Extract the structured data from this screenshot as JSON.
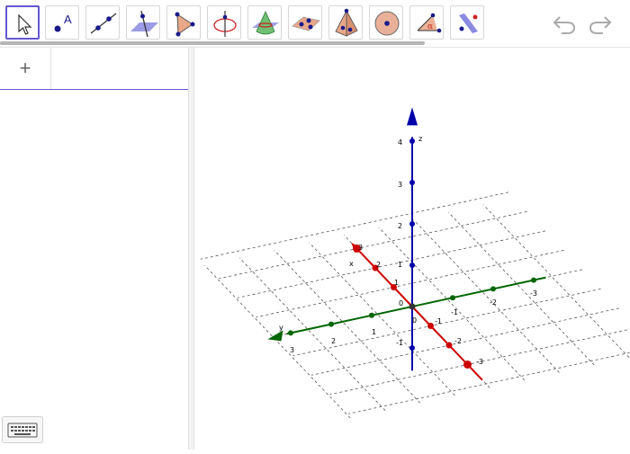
{
  "toolbar": {
    "tools": [
      {
        "name": "move-tool",
        "icon": "cursor-arrow-icon",
        "selected": true
      },
      {
        "name": "point-tool",
        "icon": "point-with-label-icon",
        "label": "A"
      },
      {
        "name": "line-tool",
        "icon": "line-through-points-icon"
      },
      {
        "name": "perpendicular-line-tool",
        "icon": "perpendicular-line-plane-icon"
      },
      {
        "name": "polygon-tool",
        "icon": "polygon-icon"
      },
      {
        "name": "circle-axis-tool",
        "icon": "circle-around-axis-icon"
      },
      {
        "name": "intersect-surfaces-tool",
        "icon": "intersect-surfaces-icon"
      },
      {
        "name": "plane-three-points-tool",
        "icon": "plane-through-points-icon"
      },
      {
        "name": "pyramid-tool",
        "icon": "pyramid-icon"
      },
      {
        "name": "sphere-tool",
        "icon": "sphere-icon"
      },
      {
        "name": "angle-tool",
        "icon": "angle-icon",
        "label": "α"
      },
      {
        "name": "reflect-plane-tool",
        "icon": "reflect-about-plane-icon"
      }
    ],
    "undo_icon": "undo-icon",
    "redo_icon": "redo-icon"
  },
  "algebra": {
    "add_label": "+",
    "keyboard_icon": "keyboard-icon"
  },
  "view3d": {
    "colors": {
      "x": "#cc0000",
      "y": "#006600",
      "z": "#0000aa",
      "grid": "#555555"
    },
    "z_axis": {
      "label": "z",
      "ticks": [
        "1",
        "2",
        "3",
        "4"
      ],
      "neg_ticks": [
        "-1"
      ]
    },
    "x_axis": {
      "label": "x",
      "pos_ticks": [
        "1",
        "2",
        "3"
      ],
      "neg_ticks": [
        "-1",
        "-2",
        "-3"
      ]
    },
    "y_axis": {
      "label": "y",
      "pos_ticks": [
        "1",
        "2",
        "3"
      ],
      "neg_ticks": [
        "-1",
        "-2",
        "-3"
      ]
    },
    "origin_label": "0"
  }
}
